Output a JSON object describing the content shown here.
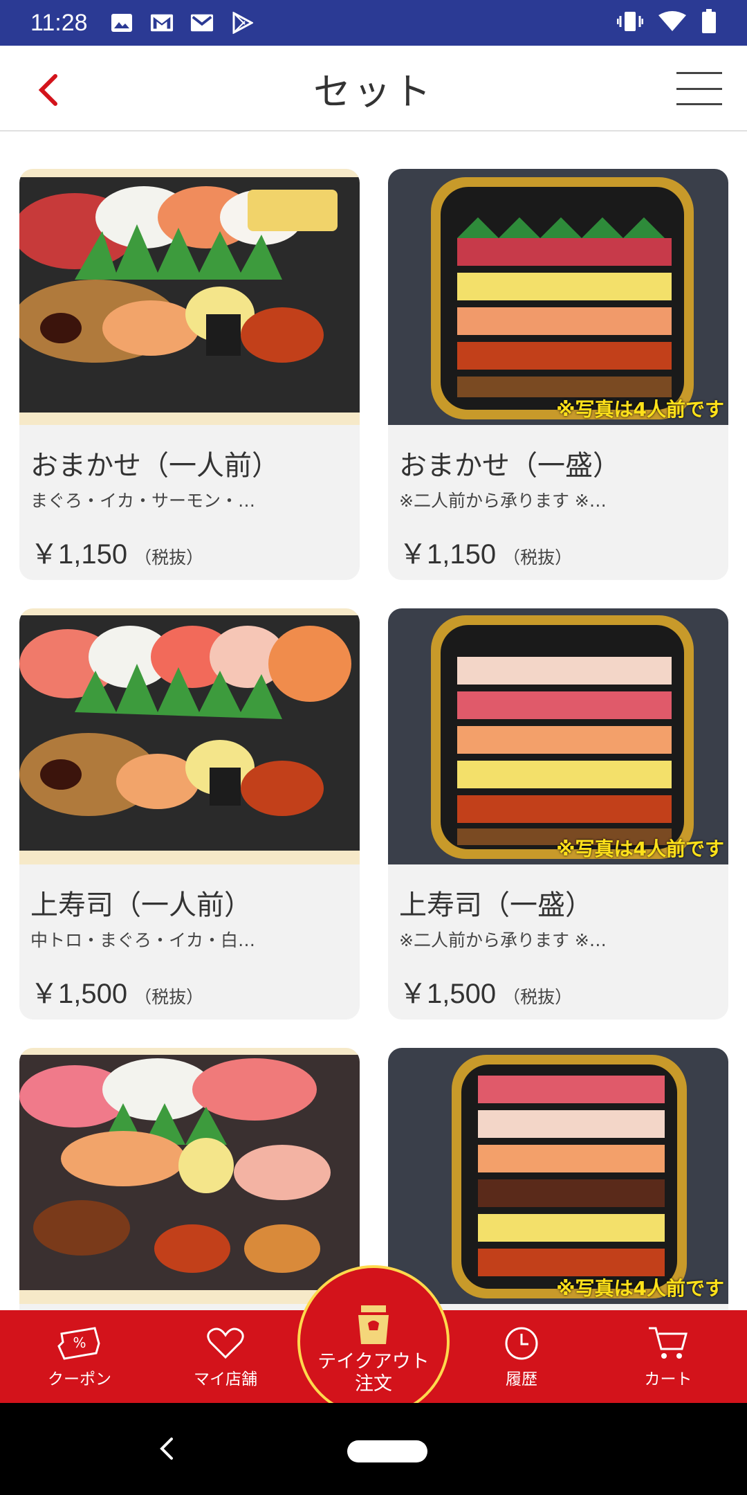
{
  "status_bar": {
    "time": "11:28"
  },
  "header": {
    "title": "セット"
  },
  "products": [
    {
      "name": "おまかせ（一人前）",
      "description": "まぐろ・イカ・サーモン・…",
      "price": "￥1,150",
      "tax": "（税抜）",
      "photo_note": ""
    },
    {
      "name": "おまかせ（一盛）",
      "description": "※二人前から承ります ※…",
      "price": "￥1,150",
      "tax": "（税抜）",
      "photo_note": "※写真は4人前です"
    },
    {
      "name": "上寿司（一人前）",
      "description": "中トロ・まぐろ・イカ・白…",
      "price": "￥1,500",
      "tax": "（税抜）",
      "photo_note": ""
    },
    {
      "name": "上寿司（一盛）",
      "description": "※二人前から承ります ※…",
      "price": "￥1,500",
      "tax": "（税抜）",
      "photo_note": "※写真は4人前です"
    },
    {
      "name": "",
      "description": "",
      "price": "",
      "tax": "",
      "photo_note": ""
    },
    {
      "name": "",
      "description": "",
      "price": "",
      "tax": "",
      "photo_note": "※写真は4人前です"
    }
  ],
  "bottom_nav": {
    "coupon": "クーポン",
    "my_store": "マイ店舗",
    "takeout_line1": "テイクアウト",
    "takeout_line2": "注文",
    "history": "履歴",
    "cart": "カート"
  },
  "colors": {
    "brand_red": "#d3131b",
    "status_bar": "#2b3a94",
    "note_yellow": "#ffe11a"
  }
}
